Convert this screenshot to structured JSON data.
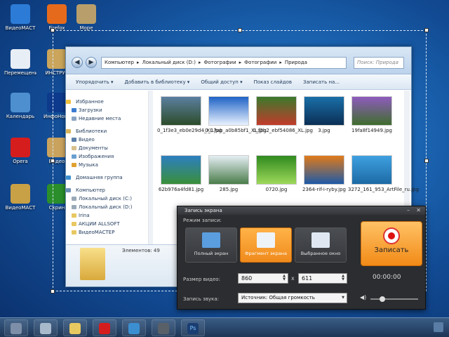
{
  "desktop": {
    "icons": [
      {
        "label": "ВидеоМАСТ",
        "color": "#2c7bd6"
      },
      {
        "label": "Firefox",
        "color": "#e66a1b"
      },
      {
        "label": "Море",
        "color": "#b89e6a"
      },
      {
        "label": "Перемещени статей.txt",
        "color": "#e8eef5"
      },
      {
        "label": "ИНСТРУК",
        "color": "#caa55b"
      },
      {
        "label": "Календарь",
        "color": "#4d8fcf"
      },
      {
        "label": "ИнфоНова",
        "color": "#0d3a8c"
      },
      {
        "label": "Opera",
        "color": "#d61d1d"
      },
      {
        "label": "Видео",
        "color": "#c9a35e"
      },
      {
        "label": "ВидеоМАСТ",
        "color": "#c8a046"
      },
      {
        "label": "Скрин",
        "color": "#2a8f2a"
      }
    ]
  },
  "explorer": {
    "address": [
      "Компьютер",
      "Локальный диск (D:)",
      "Фотографии",
      "Фотографии",
      "Природа"
    ],
    "search_placeholder": "Поиск: Природа",
    "toolbar": [
      "Упорядочить ▾",
      "Добавить в библиотеку ▾",
      "Общий доступ ▾",
      "Показ слайдов",
      "Записать на..."
    ],
    "sidebar": [
      {
        "label": "Избранное",
        "head": true,
        "color": "#f0c040"
      },
      {
        "label": "Загрузки",
        "head": false,
        "color": "#3b7bd0"
      },
      {
        "label": "Недавние места",
        "head": false,
        "color": "#8aa4c4"
      },
      {
        "label": "Библиотеки",
        "head": true,
        "color": "#d8b55a"
      },
      {
        "label": "Видео",
        "head": false,
        "color": "#5d7fa8"
      },
      {
        "label": "Документы",
        "head": false,
        "color": "#d8c08a"
      },
      {
        "label": "Изображения",
        "head": false,
        "color": "#6aa0d0"
      },
      {
        "label": "Музыка",
        "head": false,
        "color": "#e0a030"
      },
      {
        "label": "Домашняя группа",
        "head": true,
        "color": "#3d8fd0"
      },
      {
        "label": "Компьютер",
        "head": true,
        "color": "#6a8fb5"
      },
      {
        "label": "Локальный диск (C:)",
        "head": false,
        "color": "#9aa9b8"
      },
      {
        "label": "Локальный диск (D:)",
        "head": false,
        "color": "#9aa9b8"
      },
      {
        "label": "Irina",
        "head": false,
        "color": "#e8c860"
      },
      {
        "label": "АКЦИИ ALLSOFT",
        "head": false,
        "color": "#e8c860"
      },
      {
        "label": "ВидеоМАСТЕР",
        "head": false,
        "color": "#e8c860"
      }
    ],
    "files": [
      {
        "name": "0_1f3e3_eb0e29d4_XL.jpg",
        "c1": "#5b7fa0",
        "c2": "#2d4d2a"
      },
      {
        "name": "0_17ab_a0b85bf1_XL.jpg",
        "c1": "#1f63c6",
        "c2": "#e8f2ff"
      },
      {
        "name": "0_f2b2_ebf54086_XL.jpg",
        "c1": "#3b7a2c",
        "c2": "#c23b2b"
      },
      {
        "name": "3.jpg",
        "c1": "#1a6fa8",
        "c2": "#0b2f55"
      },
      {
        "name": "19fa8f14949.jpg",
        "c1": "#8e5bbd",
        "c2": "#3f6d2d"
      },
      {
        "name": "62b976a4fd81.jpg",
        "c1": "#2d7fc0",
        "c2": "#3a8f3a"
      },
      {
        "name": "285.jpg",
        "c1": "#e5edf3",
        "c2": "#4a7d4a"
      },
      {
        "name": "0720.jpg",
        "c1": "#2f8a1e",
        "c2": "#9ed85a"
      },
      {
        "name": "2364-rif-i-ryby.jpg",
        "c1": "#e07a1a",
        "c2": "#1e5aa8"
      },
      {
        "name": "3272_161_953_ArtFile_ru.jpg",
        "c1": "#3fa0e0",
        "c2": "#1c6aa5"
      }
    ],
    "status": "Элементов: 49"
  },
  "recorder": {
    "title": "Запись экрана",
    "mode_label": "Режим записи:",
    "modes": [
      {
        "label": "Полный экран",
        "active": false
      },
      {
        "label": "Фрагмент экрана",
        "active": true
      },
      {
        "label": "Выбранное окно",
        "active": false
      }
    ],
    "record_label": "Записать",
    "size_label": "Размер видео:",
    "width": "860",
    "times": "x",
    "height": "611",
    "timer": "00:00:00",
    "sound_label": "Запись звука:",
    "sound_source": "Источник: Общая громкость",
    "volume": 0.25
  },
  "taskbar": {
    "items": [
      {
        "name": "taskbar-item-1",
        "color": "#7d8fa8"
      },
      {
        "name": "taskbar-item-2",
        "color": "#a9b9cc"
      },
      {
        "name": "taskbar-explorer",
        "color": "#e8c860"
      },
      {
        "name": "taskbar-opera",
        "color": "#d61d1d"
      },
      {
        "name": "taskbar-monitor",
        "color": "#3b8fd0"
      },
      {
        "name": "taskbar-recorder",
        "color": "#5a6068"
      },
      {
        "name": "taskbar-photoshop",
        "color": "#1b3d72"
      }
    ],
    "photoshop_glyph": "Ps"
  }
}
